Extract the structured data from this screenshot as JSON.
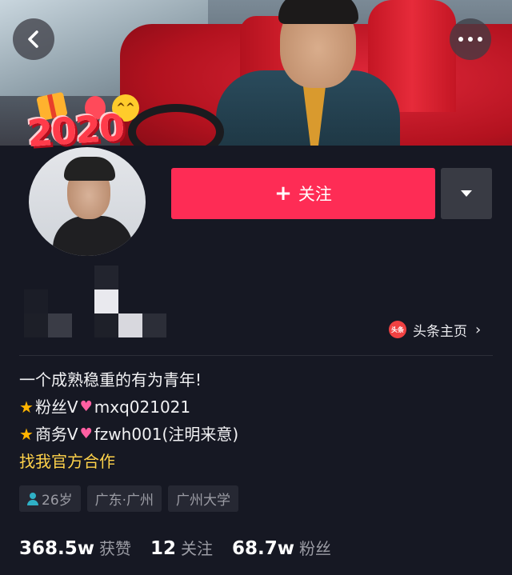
{
  "profile": {
    "follow_label": "关注",
    "toutiao_label": "头条主页",
    "toutiao_icon_text": "头条",
    "sticker_text": "2020",
    "bio": {
      "line1": "一个成熟稳重的有为青年!",
      "fans_prefix": "粉丝V",
      "fans_id": "mxq021021",
      "business_prefix": "商务V",
      "business_id": "fzwh001(注明来意)",
      "cooperate_link": "找我官方合作"
    },
    "tags": {
      "age": "26岁",
      "location": "广东·广州",
      "school": "广州大学"
    },
    "stats": {
      "likes_value": "368.5w",
      "likes_label": "获赞",
      "following_value": "12",
      "following_label": "关注",
      "followers_value": "68.7w",
      "followers_label": "粉丝"
    }
  },
  "icons": {
    "back": "chevron-left-icon",
    "more": "more-dots-icon",
    "dropdown": "caret-down-icon",
    "toutiao": "toutiao-logo-icon",
    "age": "user-icon"
  },
  "colors": {
    "background": "#161823",
    "follow_button": "#fe2c55",
    "secondary_button": "#393b44",
    "link_yellow": "#ffd24a",
    "tag_bg": "#262833",
    "muted_text": "#9b9ca4"
  }
}
